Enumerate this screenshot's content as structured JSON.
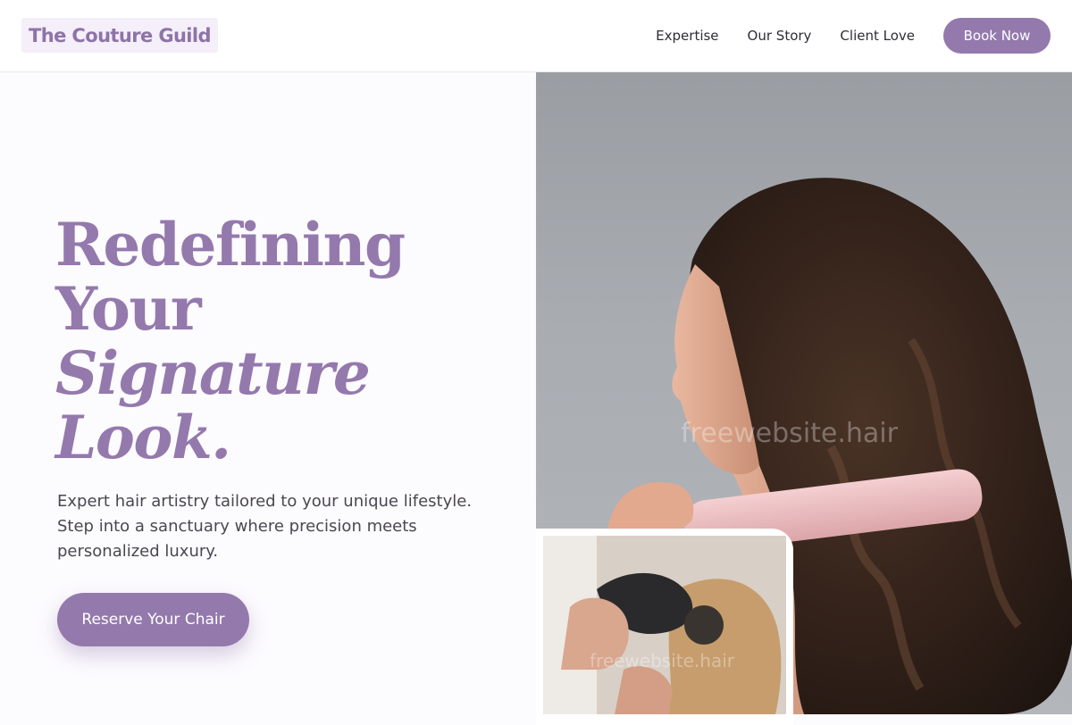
{
  "brand": {
    "name": "The Couture Guild",
    "accent_color": "#9479ad",
    "logo_bg": "#f4eff8"
  },
  "nav": {
    "links": [
      "Expertise",
      "Our Story",
      "Client Love"
    ],
    "cta_label": "Book Now"
  },
  "hero": {
    "headline_lines": [
      "Redefining",
      "Your",
      "Signature",
      "Look."
    ],
    "subtitle": "Expert hair artistry tailored to your unique lifestyle. Step into a sanctuary where precision meets personalized luxury.",
    "cta_label": "Reserve Your Chair"
  },
  "images": {
    "main_watermark": "freewebsite.hair",
    "inset_watermark": "freewebsite.hair"
  }
}
